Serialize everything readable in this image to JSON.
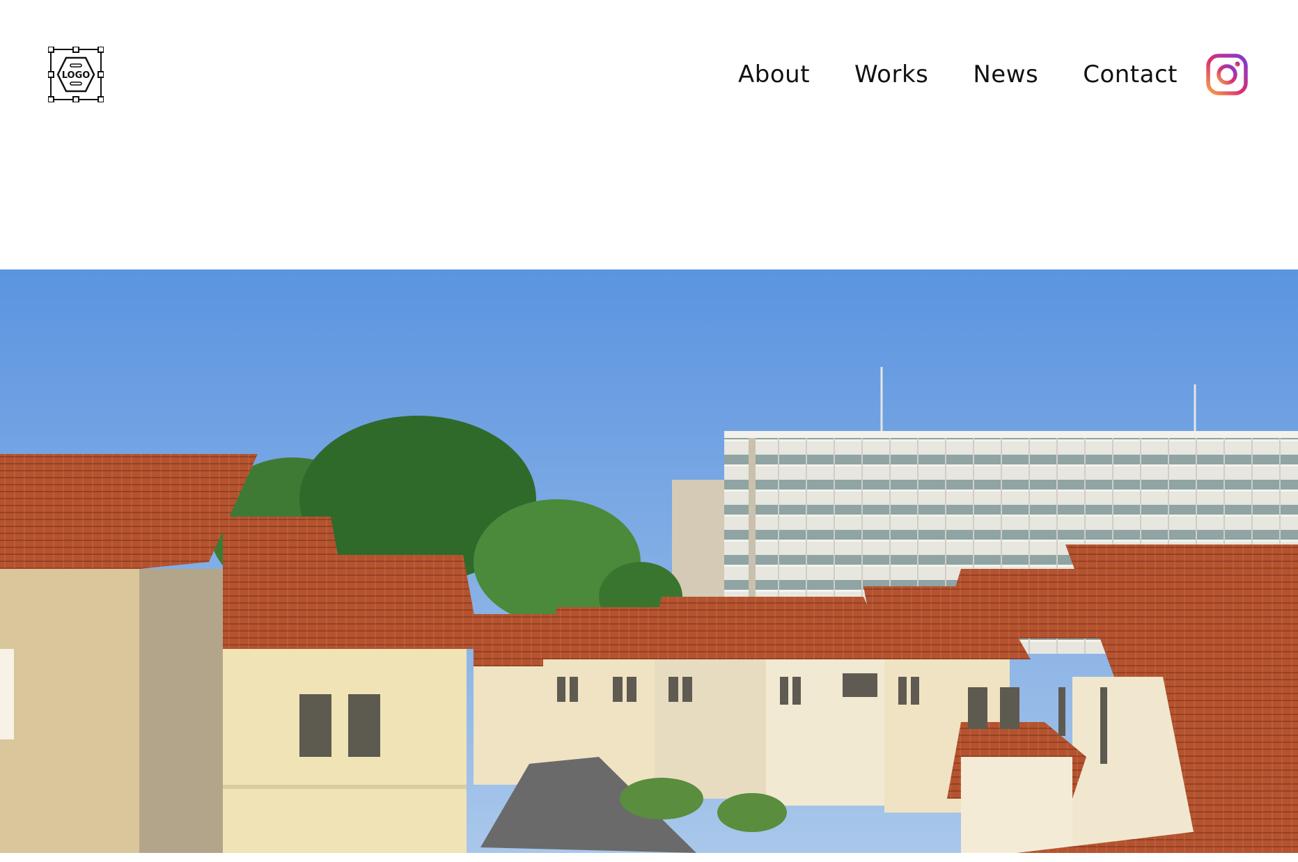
{
  "header": {
    "logo": {
      "text": "LOGO",
      "icon": "logo-placeholder-icon"
    },
    "nav": [
      {
        "label": "About"
      },
      {
        "label": "Works"
      },
      {
        "label": "News"
      },
      {
        "label": "Contact"
      }
    ],
    "social": {
      "icon": "instagram-icon"
    }
  },
  "hero": {
    "image": "residential-neighborhood-photo",
    "colors": {
      "sky_top": "#5b94e0",
      "sky_bottom": "#a9c7ea",
      "roof": "#b4532f",
      "wall": "#efe3c3",
      "trees": "#3f7a34"
    }
  }
}
